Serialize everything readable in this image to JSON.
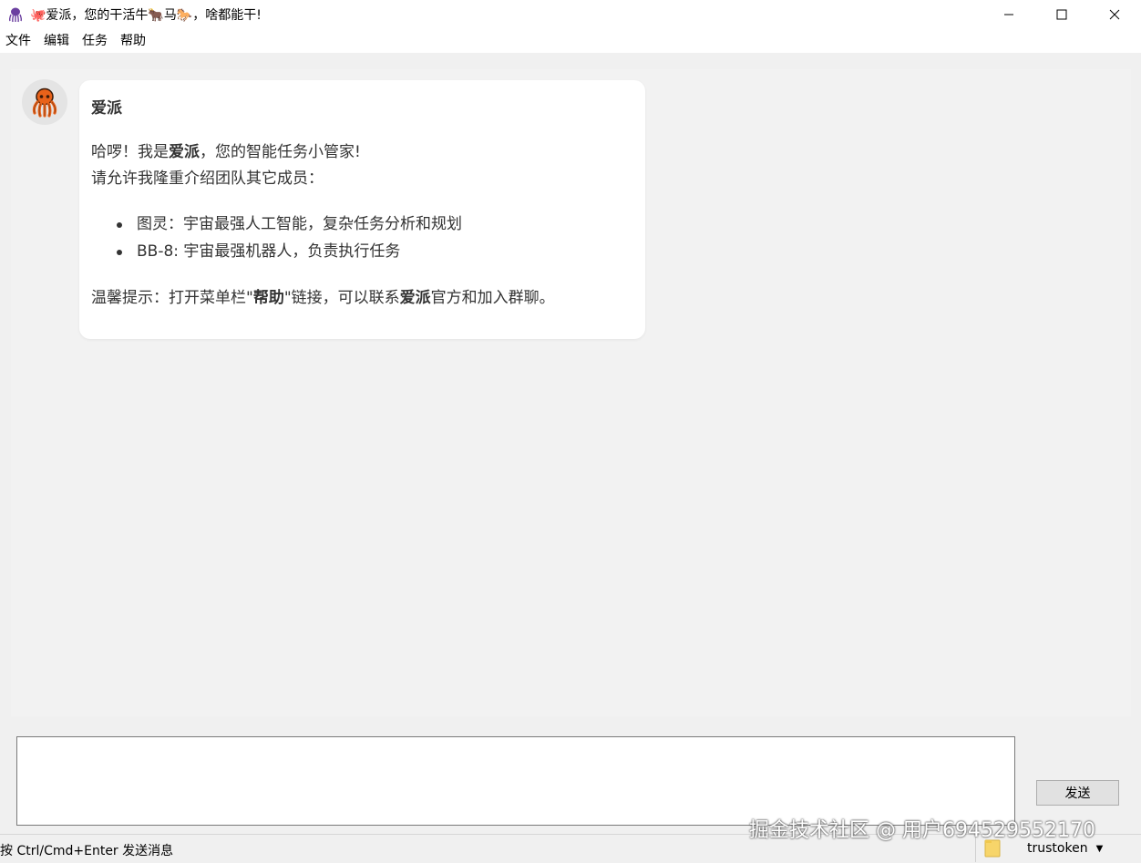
{
  "window": {
    "title": "🐙爱派，您的干活牛🐂马🐎，啥都能干!"
  },
  "menu": [
    "文件",
    "编辑",
    "任务",
    "帮助"
  ],
  "message": {
    "sender": "爱派",
    "greeting_prefix": "哈啰！我是",
    "greeting_bold": "爱派",
    "greeting_suffix": "，您的智能任务小管家!",
    "intro": "请允许我隆重介绍团队其它成员：",
    "members": [
      "图灵：宇宙最强人工智能，复杂任务分析和规划",
      "BB-8: 宇宙最强机器人，负责执行任务"
    ],
    "tip_1": "温馨提示：打开菜单栏\"",
    "tip_bold_1": "帮助",
    "tip_2": "\"链接，可以联系",
    "tip_bold_2": "爱派",
    "tip_3": "官方和加入群聊。"
  },
  "input": {
    "value": "",
    "placeholder": ""
  },
  "send_button": "发送",
  "status": {
    "hint": "按 Ctrl/Cmd+Enter 发送消息",
    "token_selected": "trustoken"
  },
  "watermark": "掘金技术社区 @ 用户694529552170",
  "colors": {
    "accent_orange": "#e8621a",
    "chat_bg": "#f2f2f2",
    "bubble_bg": "#ffffff"
  },
  "icons": {
    "app": "octopus-icon",
    "avatar": "octopus-avatar",
    "folder": "folder-icon"
  }
}
